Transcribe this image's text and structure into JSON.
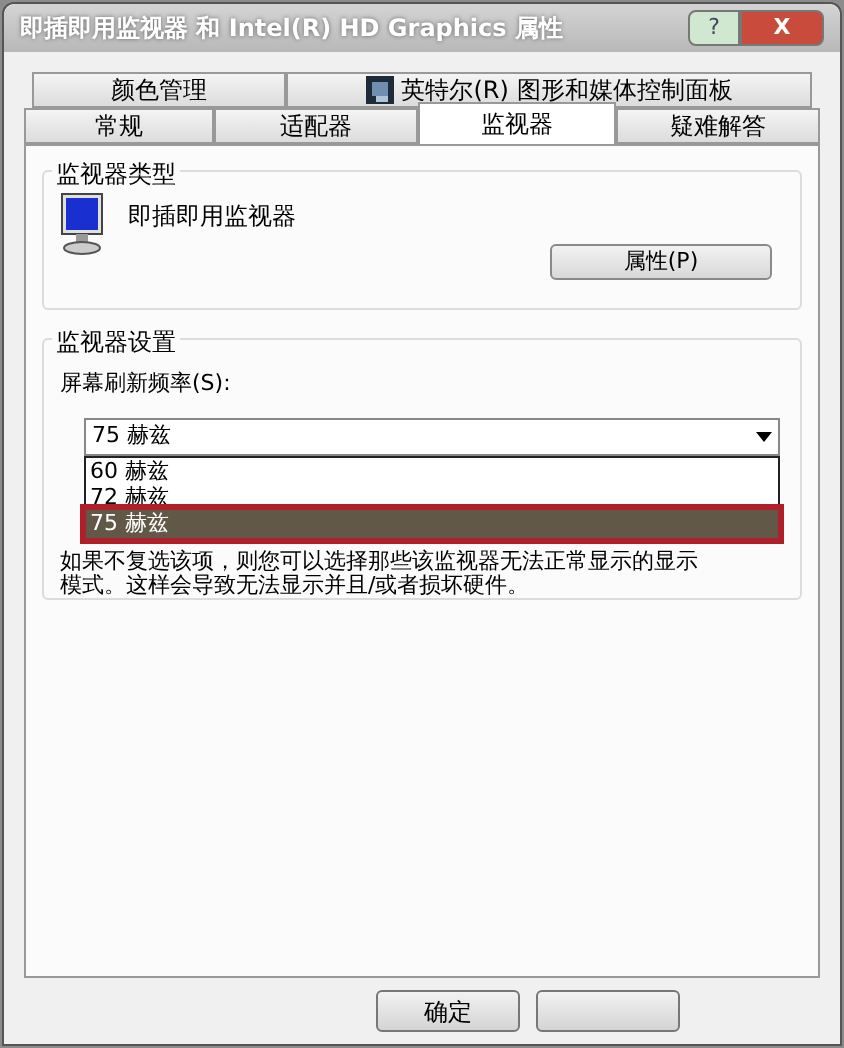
{
  "window": {
    "title": "即插即用监视器 和 Intel(R) HD Graphics 属性",
    "help_button": "?",
    "close_button": "X"
  },
  "tab_rows": [
    [
      {
        "label": "颜色管理",
        "selected": false,
        "icon": false
      },
      {
        "label": "英特尔(R) 图形和媒体控制面板",
        "selected": false,
        "icon": true
      }
    ],
    [
      {
        "label": "常规",
        "selected": false,
        "icon": false
      },
      {
        "label": "适配器",
        "selected": false,
        "icon": false
      },
      {
        "label": "监视器",
        "selected": true,
        "icon": false
      },
      {
        "label": "疑难解答",
        "selected": false,
        "icon": false
      }
    ]
  ],
  "monitor_type": {
    "title": "监视器类型",
    "name": "即插即用监视器",
    "properties_button": "属性(P)"
  },
  "monitor_settings": {
    "title": "监视器设置",
    "refresh_label": "屏幕刷新频率(S):",
    "refresh_value": "75 赫兹",
    "options": [
      {
        "label": "60 赫兹",
        "selected": false,
        "annotated": false
      },
      {
        "label": "72 赫兹",
        "selected": false,
        "annotated": false
      },
      {
        "label": "75 赫兹",
        "selected": true,
        "annotated": true
      }
    ],
    "warning": "如果不复选该项，则您可以选择那些该监视器无法正常显示的显示模式。这样会导致无法显示并且/或者损坏硬件。"
  },
  "ok_button": "确定"
}
